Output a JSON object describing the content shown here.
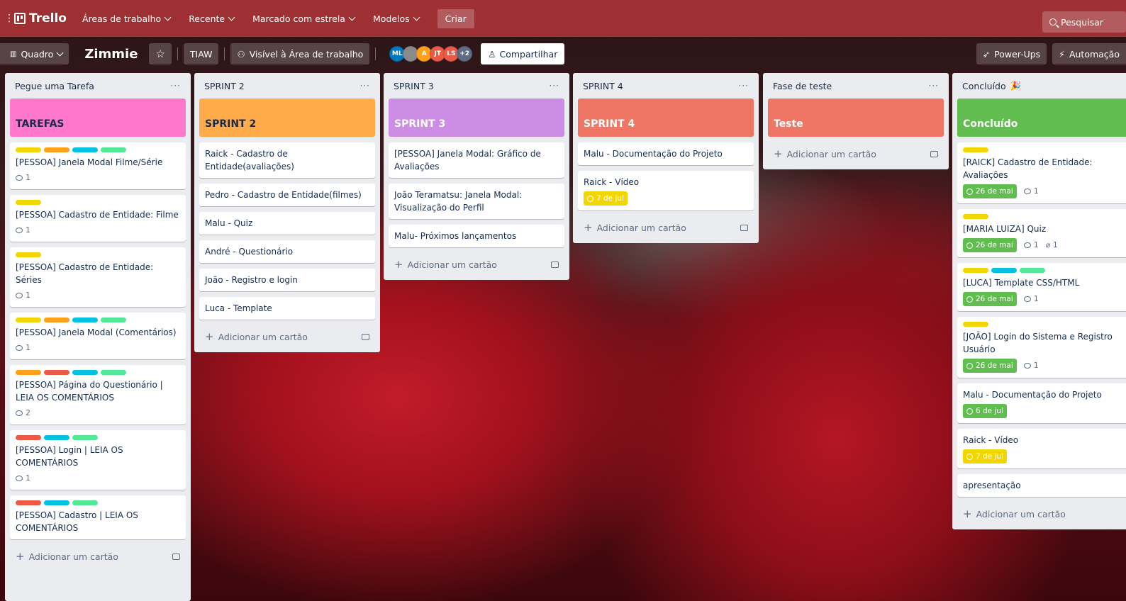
{
  "colors": {
    "topbar": "#9e2f33",
    "green": "#61bd4f",
    "yellow": "#f2d600",
    "orange": "#ff9f1a",
    "blue": "#00c2e0",
    "lime": "#51e898",
    "red": "#eb5a46",
    "pink": "#ff78cb",
    "purple": "#c377e0"
  },
  "topnav": {
    "logo": "Trello",
    "workspaces": "Áreas de trabalho",
    "recent": "Recente",
    "starred": "Marcado com estrela",
    "templates": "Modelos",
    "create": "Criar",
    "search": "Pesquisar"
  },
  "board": {
    "view": "Quadro",
    "title": "Zimmie",
    "workspace": "TIAW",
    "visibility": "Visível à Área de trabalho",
    "share": "Compartilhar",
    "powerups": "Power-Ups",
    "automation": "Automação",
    "members": [
      {
        "initials": "ML",
        "color": "#0079bf"
      },
      {
        "initials": "",
        "color": "#8a8a8a"
      },
      {
        "initials": "A",
        "color": "#ff9f1a"
      },
      {
        "initials": "JT",
        "color": "#eb5a46"
      },
      {
        "initials": "LS",
        "color": "#eb5a46"
      },
      {
        "initials": "+2",
        "color": "#5e6c84"
      }
    ]
  },
  "add_card": "Adicionar um cartão",
  "lists": [
    {
      "title": "Pegue uma Tarefa",
      "cover": {
        "text": "TAREFAS",
        "color": "#ff78cb"
      },
      "cards": [
        {
          "labels": [
            "#f2d600",
            "#ff9f1a",
            "#00c2e0",
            "#51e898"
          ],
          "title": "[PESSOA] Janela Modal Filme/Série",
          "comments": "1"
        },
        {
          "labels": [
            "#f2d600"
          ],
          "title": "[PESSOA] Cadastro de Entidade: Filme",
          "comments": "1"
        },
        {
          "labels": [
            "#f2d600"
          ],
          "title": "[PESSOA] Cadastro de Entidade: Séries",
          "comments": "1"
        },
        {
          "labels": [
            "#f2d600",
            "#ff9f1a",
            "#00c2e0",
            "#51e898"
          ],
          "title": "[PESSOA] Janela Modal (Comentários)",
          "comments": "1"
        },
        {
          "labels": [
            "#ff9f1a",
            "#eb5a46",
            "#00c2e0",
            "#51e898"
          ],
          "title": "[PESSOA] Página do Questionário | LEIA OS COMENTÁRIOS",
          "comments": "2"
        },
        {
          "labels": [
            "#eb5a46",
            "#00c2e0",
            "#51e898"
          ],
          "title": "[PESSOA] Login | LEIA OS COMENTÁRIOS",
          "comments": "1"
        },
        {
          "labels": [
            "#eb5a46",
            "#00c2e0",
            "#51e898"
          ],
          "title": "[PESSOA] Cadastro | LEIA OS COMENTÁRIOS",
          "comments": ""
        }
      ]
    },
    {
      "title": "SPRINT 2",
      "cover": {
        "text": "SPRINT 2",
        "color": "#ffab4a"
      },
      "cards": [
        {
          "title": "Raick - Cadastro de Entidade(avaliações)"
        },
        {
          "title": "Pedro - Cadastro de Entidade(filmes)"
        },
        {
          "title": "Malu - Quiz"
        },
        {
          "title": "André - Questionário"
        },
        {
          "title": "João - Registro e login"
        },
        {
          "title": "Luca - Template"
        }
      ]
    },
    {
      "title": "SPRINT 3",
      "cover": {
        "text": "SPRINT 3",
        "color": "#cd8de5"
      },
      "cards": [
        {
          "title": "[PESSOA] Janela Modal: Gráfico de Avaliações"
        },
        {
          "title": "João Teramatsu: Janela Modal: Visualização do Perfil"
        },
        {
          "title": "Malu- Próximos lançamentos"
        }
      ]
    },
    {
      "title": "SPRINT 4",
      "cover": {
        "text": "SPRINT 4",
        "color": "#ef7564"
      },
      "cards": [
        {
          "title": "Malu - Documentação do Projeto"
        },
        {
          "title": "Raick - Vídeo",
          "due": {
            "text": "7 de jul",
            "color": "#f2d600"
          }
        }
      ]
    },
    {
      "title": "Fase de teste",
      "cover": {
        "text": "Teste",
        "color": "#ef7564"
      },
      "cards": []
    },
    {
      "title": "Concluído",
      "cover": {
        "text": "Concluído",
        "color": "#61bd4f"
      },
      "cards": [
        {
          "labels": [
            "#f2d600"
          ],
          "title": "[RAICK] Cadastro de Entidade: Avaliações",
          "due": {
            "text": "26 de mai",
            "color": "#61bd4f"
          },
          "comments": "1"
        },
        {
          "labels": [
            "#f2d600"
          ],
          "title": "[MARIA LUIZA] Quiz",
          "due": {
            "text": "26 de mai",
            "color": "#61bd4f"
          },
          "comments": "1",
          "attachments": "1"
        },
        {
          "labels": [
            "#f2d600",
            "#00c2e0",
            "#51e898"
          ],
          "title": "[LUCA] Template CSS/HTML",
          "due": {
            "text": "26 de mai",
            "color": "#61bd4f"
          },
          "comments": "1"
        },
        {
          "labels": [
            "#f2d600"
          ],
          "title": "[JOÃO] Login do Sistema e Registro Usuário",
          "due": {
            "text": "26 de mai",
            "color": "#61bd4f"
          },
          "comments": "1"
        },
        {
          "title": "Malu - Documentação do Projeto",
          "due": {
            "text": "6 de jul",
            "color": "#61bd4f"
          }
        },
        {
          "title": "Raick - Vídeo",
          "due": {
            "text": "7 de jul",
            "color": "#f2d600"
          }
        },
        {
          "title": "apresentação"
        }
      ]
    }
  ]
}
